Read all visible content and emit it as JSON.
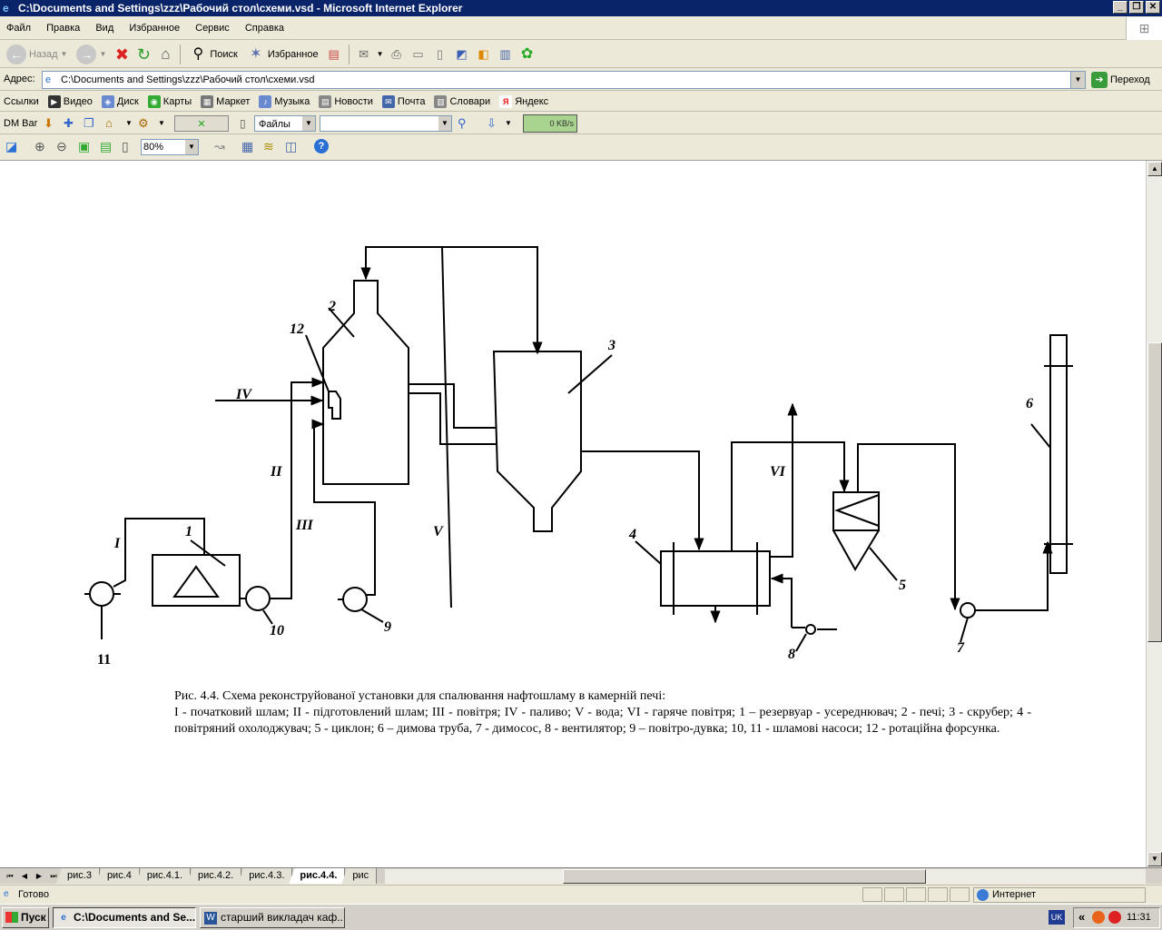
{
  "window": {
    "title": "C:\\Documents and Settings\\zzz\\Рабочий стол\\схеми.vsd - Microsoft Internet Explorer",
    "controls": [
      "_",
      "❐",
      "✕"
    ]
  },
  "menu": [
    "Файл",
    "Правка",
    "Вид",
    "Избранное",
    "Сервис",
    "Справка"
  ],
  "toolbar": {
    "back": "Назад",
    "search": "Поиск",
    "favorites": "Избранное"
  },
  "address": {
    "label": "Адрес:",
    "value": "C:\\Documents and Settings\\zzz\\Рабочий стол\\схеми.vsd",
    "go": "Переход"
  },
  "links": {
    "label": "Ссылки",
    "items": [
      "Видео",
      "Диск",
      "Карты",
      "Маркет",
      "Музыка",
      "Новости",
      "Почта",
      "Словари",
      "Яндекс"
    ]
  },
  "dmbar": {
    "label": "DM Bar",
    "files": "Файлы",
    "speed": "0 KB/s"
  },
  "vsdbar": {
    "zoom": "80%"
  },
  "diagram": {
    "labels": {
      "n1": "1",
      "n2": "2",
      "n3": "3",
      "n4": "4",
      "n5": "5",
      "n6": "6",
      "n7": "7",
      "n8": "8",
      "n9": "9",
      "n10": "10",
      "n11": "11",
      "n12": "12",
      "r1": "I",
      "r2": "II",
      "r3": "III",
      "r4": "IV",
      "r5": "V",
      "r6": "VI"
    },
    "caption_title": "Рис. 4.4. Схема реконструйованої установки для спалювання нафтошламу в камерній печі:",
    "caption_legend": "I - початковий шлам; II - підготовлений шлам; III - повітря; IV - паливо; V - вода; VI - гаряче повітря; 1 – резервуар - усереднювач; 2 - печі; 3 - скрубер; 4 - повітряний охолоджувач; 5 - циклон; 6 – димова труба, 7 - димосос, 8 - вентилятор; 9 – повітро-дувка; 10, 11 - шламові насоси; 12 - ротаційна форсунка."
  },
  "sheet_tabs": [
    "рис.3",
    "рис.4",
    "рис.4.1.",
    "рис.4.2.",
    "рис.4.3.",
    "рис.4.4.",
    "рис"
  ],
  "active_tab": "рис.4.4.",
  "status": {
    "text": "Готово",
    "zone": "Интернет"
  },
  "taskbar": {
    "start": "Пуск",
    "tasks": [
      "C:\\Documents and Se...",
      "старший викладач каф..."
    ],
    "lang": "UK",
    "tray_chevron": "«",
    "time": "11:31"
  }
}
